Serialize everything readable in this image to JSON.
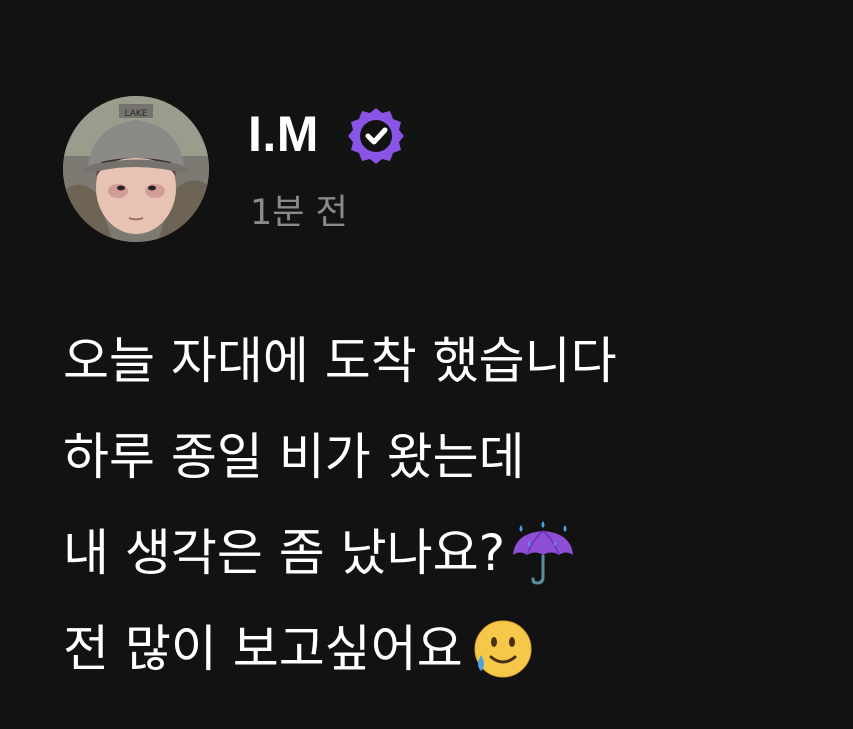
{
  "post": {
    "author": {
      "name": "I.M",
      "verified": true,
      "verified_color": "#8a55e6"
    },
    "timestamp": "1분 전",
    "body_lines": [
      "오늘 자대에 도착 했습니다",
      "하루 종일 비가 왔는데",
      "내 생각은 좀 났나요?",
      "전 많이 보고싶어요"
    ],
    "emojis": {
      "line3": "umbrella-with-rain-icon",
      "line4": "smiling-face-with-tear-icon"
    }
  },
  "colors": {
    "background": "#131213",
    "text": "#ffffff",
    "muted": "#8a8a8e"
  }
}
